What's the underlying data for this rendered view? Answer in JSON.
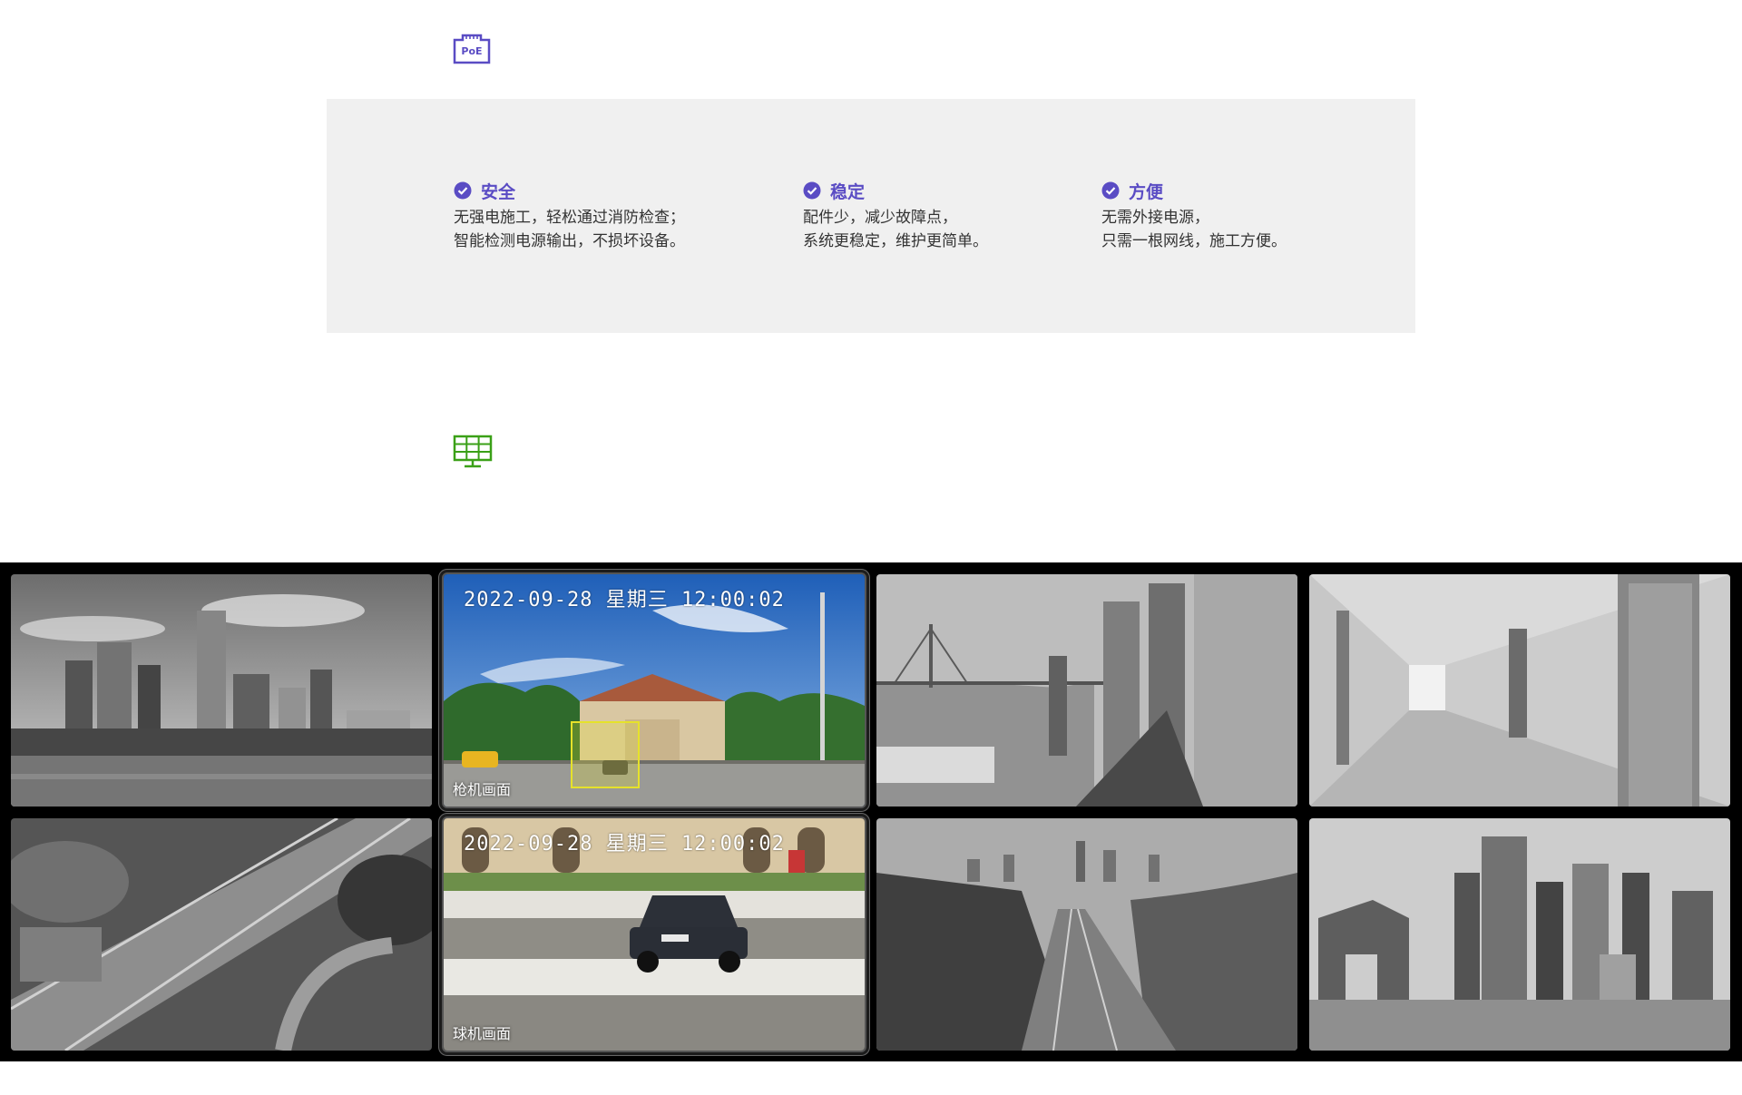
{
  "poe_icon": {
    "text": "PoE",
    "color": "#5a4cc4"
  },
  "features": [
    {
      "title": "安全",
      "lines": [
        "无强电施工，轻松通过消防检查；",
        "智能检测电源输出，不损坏设备。"
      ]
    },
    {
      "title": "稳定",
      "lines": [
        "配件少，减少故障点，",
        "系统更稳定，维护更简单。"
      ]
    },
    {
      "title": "方便",
      "lines": [
        "无需外接电源，",
        "只需一根网线，施工方便。"
      ]
    }
  ],
  "colors": {
    "accent": "#5a4cc4",
    "multiview_icon": "#3aa017",
    "panel_bg": "#f0f0f0",
    "wall_bg": "#000000"
  },
  "video_wall": {
    "tiles": [
      {
        "scene": "city-skyline-river",
        "grayscale": true
      },
      {
        "scene": "building-street-car",
        "grayscale": false,
        "timestamp": "2022-09-28 星期三  12:00:02",
        "label": "枪机画面"
      },
      {
        "scene": "river-bridge-highrise",
        "grayscale": true
      },
      {
        "scene": "hotel-corridor",
        "grayscale": true
      },
      {
        "scene": "highway-aerial",
        "grayscale": true
      },
      {
        "scene": "street-car-closeup",
        "grayscale": false,
        "timestamp": "2022-09-28 星期三  12:00:02",
        "label": "球机画面"
      },
      {
        "scene": "highway-forest-city",
        "grayscale": true
      },
      {
        "scene": "cbd-skyscrapers",
        "grayscale": true
      }
    ]
  }
}
